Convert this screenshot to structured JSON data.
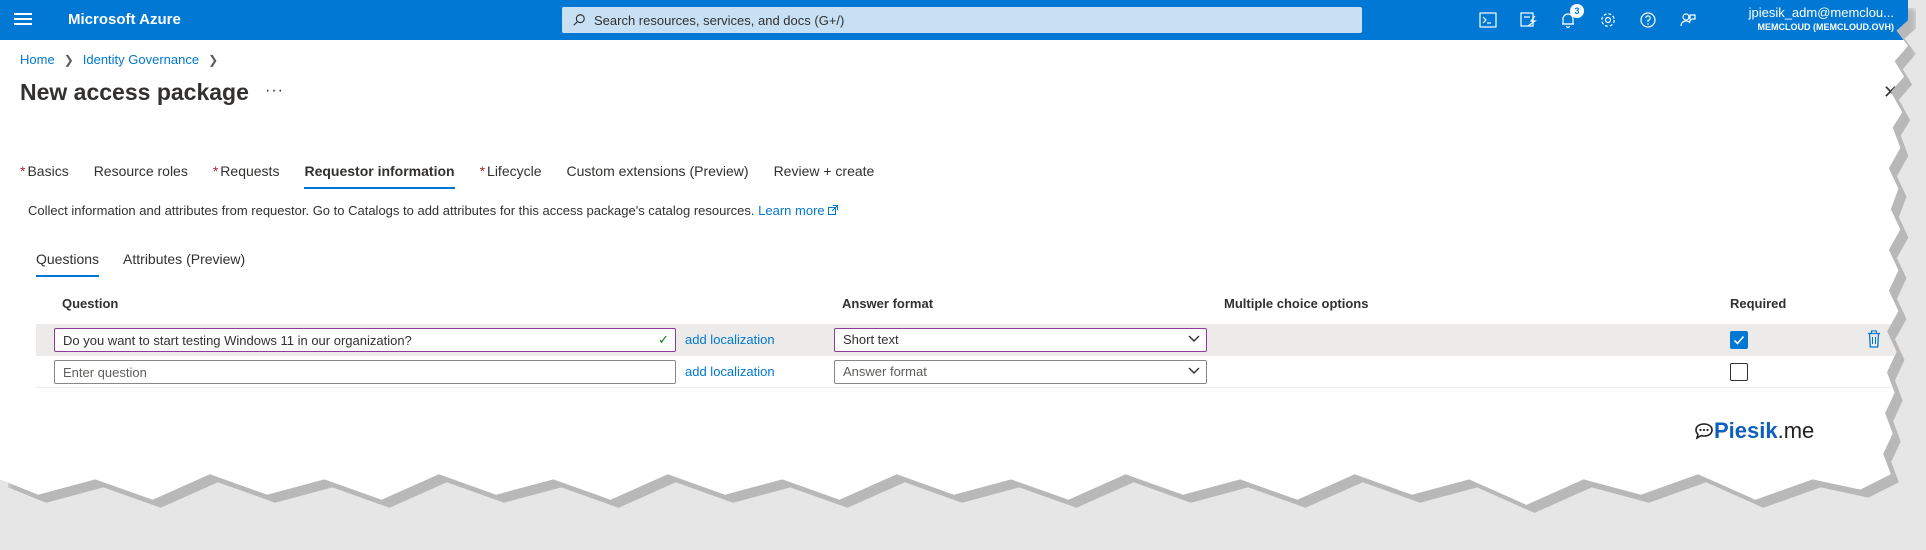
{
  "app": {
    "brand": "Microsoft Azure",
    "search_placeholder": "Search resources, services, and docs (G+/)",
    "notifications_count": "3",
    "user": "jpiesik_adm@memclou...",
    "tenant": "MEMCLOUD (MEMCLOUD.OVH)",
    "icons": [
      "cloud-shell-icon",
      "directory-filter-icon",
      "notifications-icon",
      "settings-icon",
      "help-icon",
      "feedback-icon"
    ]
  },
  "breadcrumb": [
    "Home",
    "Identity Governance"
  ],
  "page": {
    "title": "New access package",
    "more": "···",
    "close": "✕"
  },
  "tabs": [
    {
      "label": "Basics",
      "required": true
    },
    {
      "label": "Resource roles",
      "required": false
    },
    {
      "label": "Requests",
      "required": true
    },
    {
      "label": "Requestor information",
      "required": false,
      "active": true
    },
    {
      "label": "Lifecycle",
      "required": true
    },
    {
      "label": "Custom extensions (Preview)",
      "required": false
    },
    {
      "label": "Review + create",
      "required": false
    }
  ],
  "info": {
    "text": "Collect information and attributes from requestor. Go to Catalogs to add attributes for this access package's catalog resources.",
    "link": "Learn more"
  },
  "subtabs": [
    {
      "label": "Questions",
      "active": true
    },
    {
      "label": "Attributes (Preview)",
      "active": false
    }
  ],
  "table": {
    "columns": {
      "question": "Question",
      "answer_format": "Answer format",
      "multiple_choice": "Multiple choice options",
      "required": "Required"
    },
    "rows": [
      {
        "question": "Do you want to start testing Windows 11 in our organization?",
        "localization": "add localization",
        "answer_format": "Short text",
        "required": true
      },
      {
        "question_placeholder": "Enter question",
        "localization": "add localization",
        "answer_format_placeholder": "Answer format",
        "required": false
      }
    ]
  },
  "watermark": {
    "name": "Piesik",
    "suffix": ".me"
  },
  "colors": {
    "accent": "#0078d4",
    "focus_border": "#8b3a9f",
    "required_marker": "#a4262c"
  }
}
